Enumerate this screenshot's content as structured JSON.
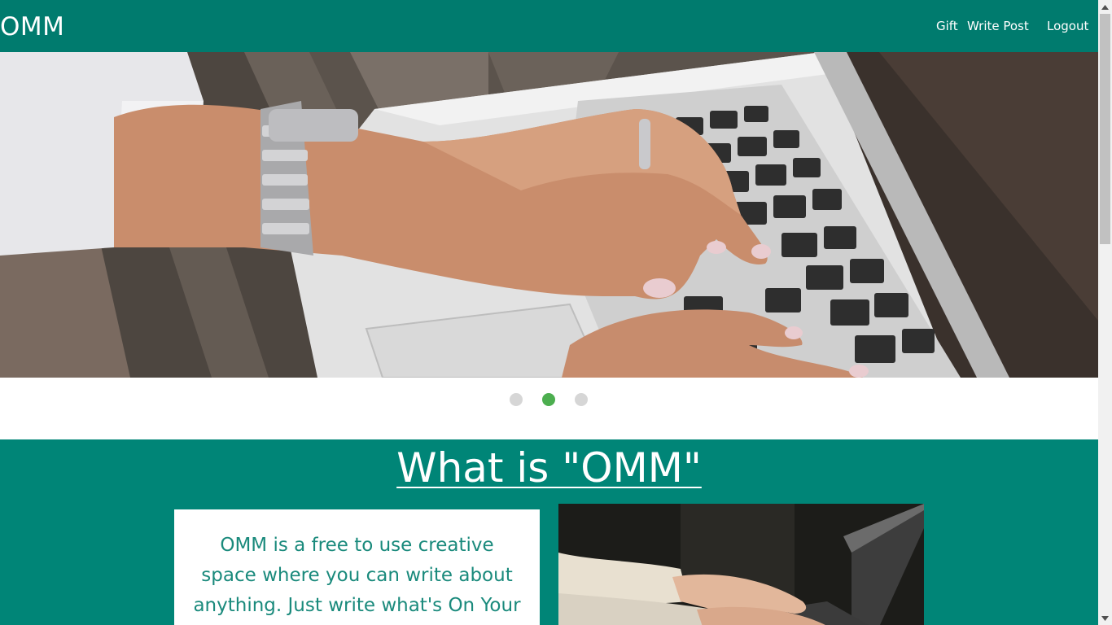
{
  "navbar": {
    "brand": "OMM",
    "links": [
      "Gift",
      "Write Post",
      "Logout"
    ],
    "background": "#007b6e"
  },
  "carousel": {
    "active_slide": 2,
    "slide_count": 3,
    "active_color": "#4cae4f",
    "inactive_color": "#d6d6d6"
  },
  "about": {
    "title": "What is \"OMM\"",
    "text": "OMM is a free to use creative space where you can write about anything. Just write what's On Your",
    "background": "#008577",
    "text_color": "#1a8a7c"
  }
}
